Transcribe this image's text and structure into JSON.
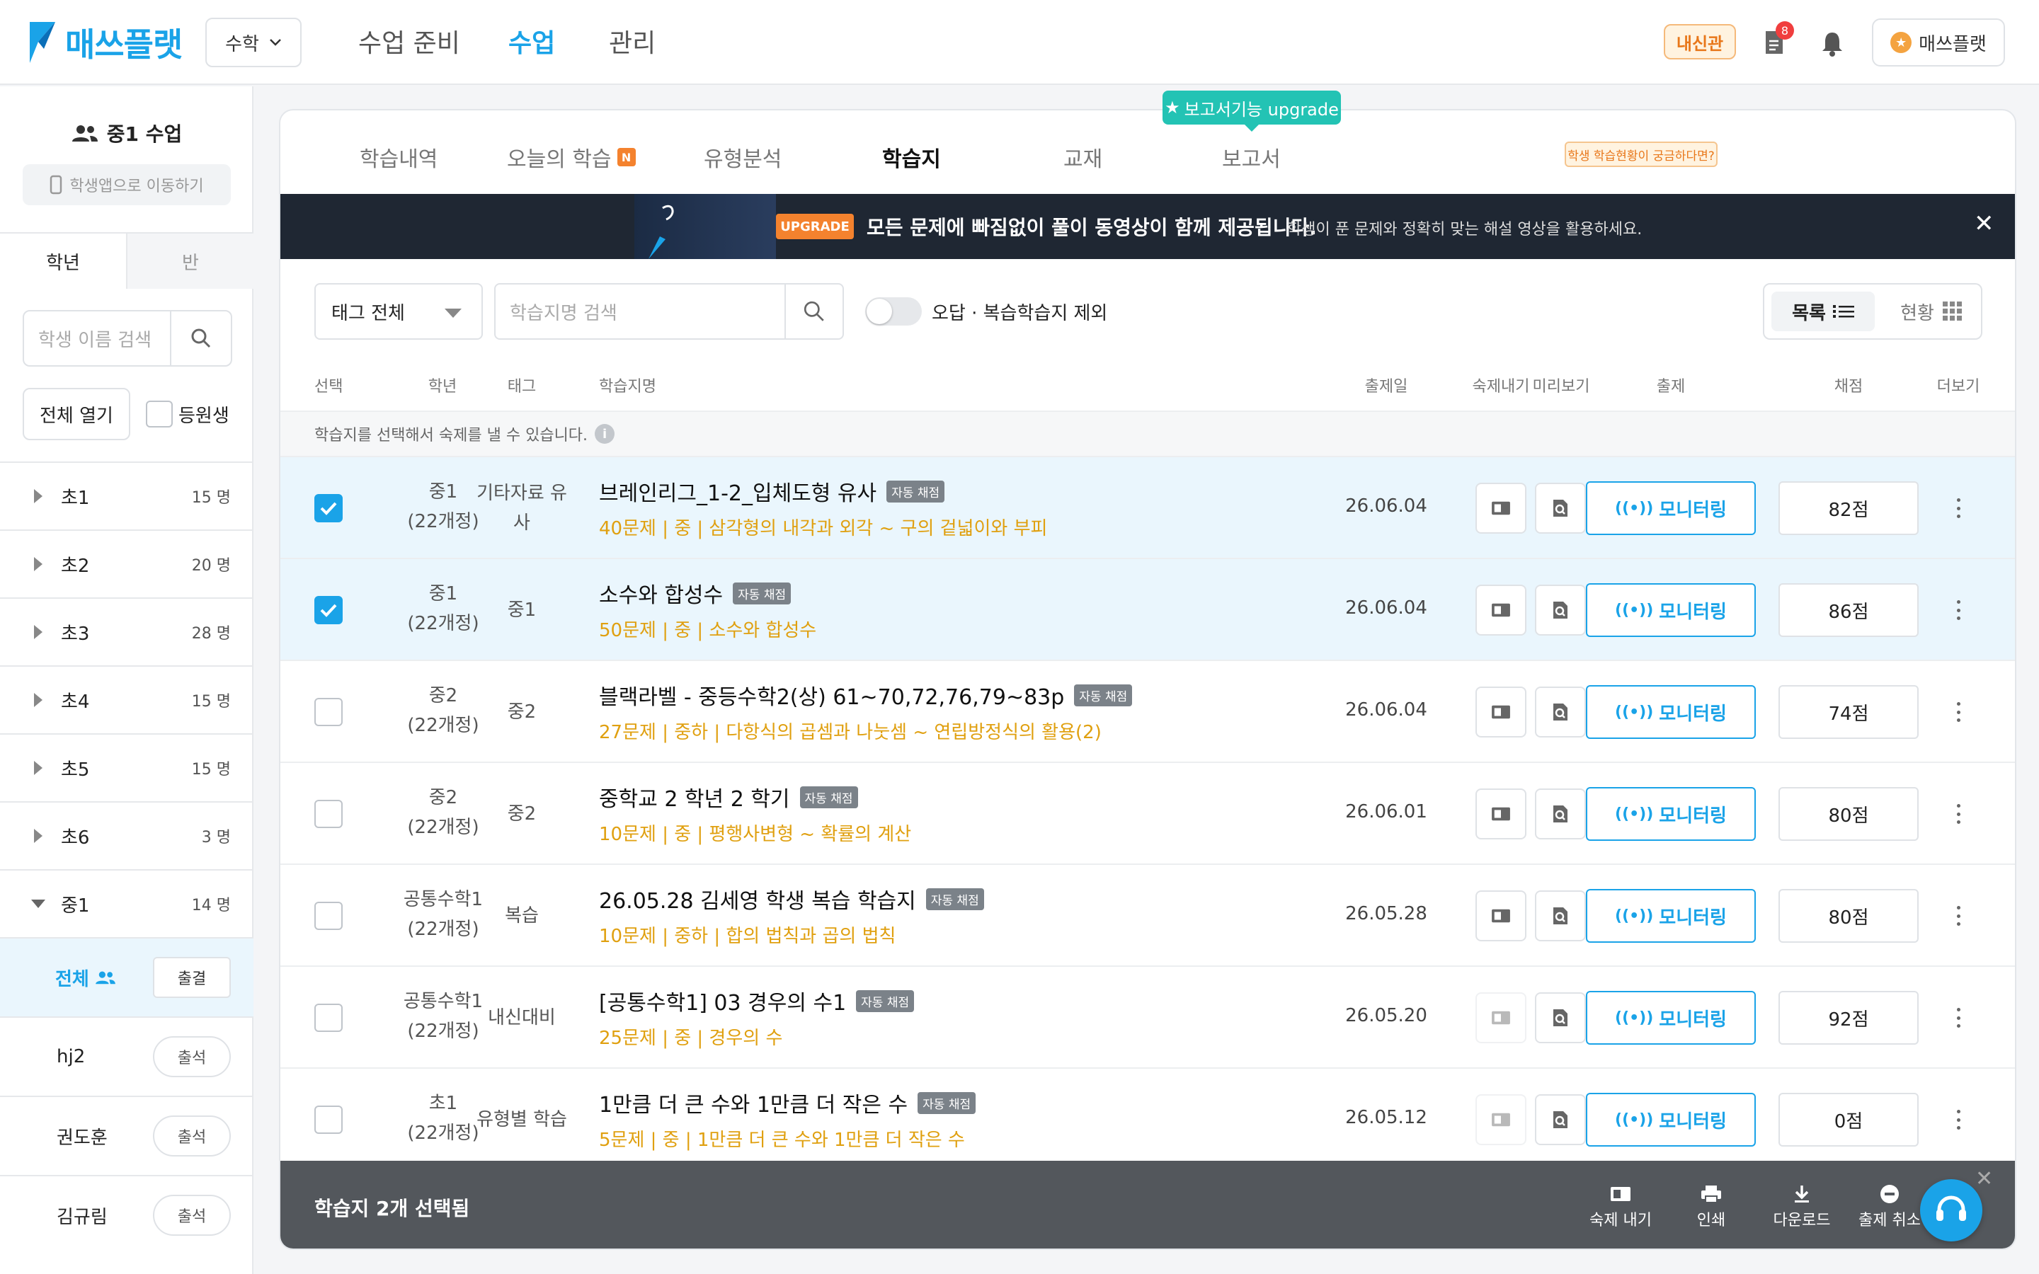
{
  "brand": {
    "name": "매쓰플랫",
    "accent": "#1aa3e8"
  },
  "subject_select": {
    "value": "수학"
  },
  "nav": [
    {
      "label": "수업 준비",
      "active": false
    },
    {
      "label": "수업",
      "active": true
    },
    {
      "label": "관리",
      "active": false
    }
  ],
  "header": {
    "naesin_badge": "내신관",
    "notification_count": "8",
    "user_label": "매쓰플랫"
  },
  "sidebar": {
    "class_title": "중1 수업",
    "student_app_button": "학생앱으로 이동하기",
    "tabs": [
      "학년",
      "반"
    ],
    "search_placeholder": "학생 이름 검색",
    "open_all_button": "전체 열기",
    "registered_label": "등원생",
    "grades": [
      {
        "name": "초1",
        "count": "15 명"
      },
      {
        "name": "초2",
        "count": "20 명"
      },
      {
        "name": "초3",
        "count": "28 명"
      },
      {
        "name": "초4",
        "count": "15 명"
      },
      {
        "name": "초5",
        "count": "15 명"
      },
      {
        "name": "초6",
        "count": "3 명"
      },
      {
        "name": "중1",
        "count": "14 명",
        "expanded": true
      }
    ],
    "all_students": {
      "label": "전체",
      "button": "출결"
    },
    "students": [
      {
        "name": "hj2",
        "button": "출석"
      },
      {
        "name": "권도훈",
        "button": "출석"
      },
      {
        "name": "김규림",
        "button": "출석"
      }
    ]
  },
  "main": {
    "tabs": [
      {
        "label": "학습내역",
        "active": false
      },
      {
        "label": "오늘의 학습",
        "badge": "N",
        "active": false
      },
      {
        "label": "유형분석",
        "active": false
      },
      {
        "label": "학습지",
        "active": true
      },
      {
        "label": "교재",
        "active": false
      },
      {
        "label": "보고서",
        "active": false
      }
    ],
    "upgrade_tooltip": "보고서기능 upgrade",
    "banner": {
      "badge": "UPGRADE",
      "headline": "모든 문제에 빠짐없이 풀이 동영상이 함께 제공됩니다.",
      "subtext": "학생이 푼 문제와 정확히 맞는 해설 영상을 활용하세요."
    },
    "filters": {
      "tag_select": "태그 전체",
      "search_placeholder": "학습지명 검색",
      "exclude_toggle_label": "오답 · 복습학습지 제외",
      "exclude_toggle_on": false,
      "view_list_label": "목록",
      "view_status_label": "현황",
      "view_hint": "학생 학습현황이 궁금하다면?"
    },
    "columns": [
      "선택",
      "학년",
      "태그",
      "학습지명",
      "출제일",
      "숙제내기",
      "미리보기",
      "출제",
      "채점",
      "더보기"
    ],
    "select_hint": "학습지를 선택해서 숙제를 낼 수 있습니다.",
    "auto_badge": "자동 채점",
    "monitor_label": "모니터링",
    "rows": [
      {
        "checked": true,
        "grade1": "중1",
        "grade2": "(22개정)",
        "tag": "기타자료 유사",
        "title": "브레인리그_1-2_입체도형 유사",
        "meta": "40문제 | 중 | 삼각형의 내각과 외각 ~ 구의 겉넓이와 부피",
        "date": "26.06.04",
        "score": "82점",
        "homework_enabled": true
      },
      {
        "checked": true,
        "grade1": "중1",
        "grade2": "(22개정)",
        "tag": "중1",
        "title": "소수와 합성수",
        "meta": "50문제 | 중 | 소수와 합성수",
        "date": "26.06.04",
        "score": "86점",
        "homework_enabled": true
      },
      {
        "checked": false,
        "grade1": "중2",
        "grade2": "(22개정)",
        "tag": "중2",
        "title": "블랙라벨 - 중등수학2(상) 61~70,72,76,79~83p",
        "meta": "27문제 | 중하 | 다항식의 곱셈과 나눗셈 ~ 연립방정식의 활용(2)",
        "date": "26.06.04",
        "score": "74점",
        "homework_enabled": true
      },
      {
        "checked": false,
        "grade1": "중2",
        "grade2": "(22개정)",
        "tag": "중2",
        "title": "중학교 2 학년 2 학기",
        "meta": "10문제 | 중 | 평행사변형 ~ 확률의 계산",
        "date": "26.06.01",
        "score": "80점",
        "homework_enabled": true
      },
      {
        "checked": false,
        "grade1": "공통수학1",
        "grade2": "(22개정)",
        "tag": "복습",
        "title": "26.05.28 김세영 학생 복습 학습지",
        "meta": "10문제 | 중하 | 합의 법칙과 곱의 법칙",
        "date": "26.05.28",
        "score": "80점",
        "homework_enabled": true
      },
      {
        "checked": false,
        "grade1": "공통수학1",
        "grade2": "(22개정)",
        "tag": "내신대비",
        "title": "[공통수학1] 03 경우의 수1",
        "meta": "25문제 | 중 | 경우의 수",
        "date": "26.05.20",
        "score": "92점",
        "homework_enabled": false
      },
      {
        "checked": false,
        "grade1": "초1",
        "grade2": "(22개정)",
        "tag": "유형별 학습",
        "title": "1만큼 더 큰 수와 1만큼 더 작은 수",
        "meta": "5문제 | 중 | 1만큼 더 큰 수와 1만큼 더 작은 수",
        "date": "26.05.12",
        "score": "0점",
        "homework_enabled": false
      }
    ],
    "bottom_bar": {
      "selected_label": "학습지 2개 선택됨",
      "actions": [
        "숙제 내기",
        "인쇄",
        "다운로드",
        "출제 취소"
      ]
    }
  }
}
